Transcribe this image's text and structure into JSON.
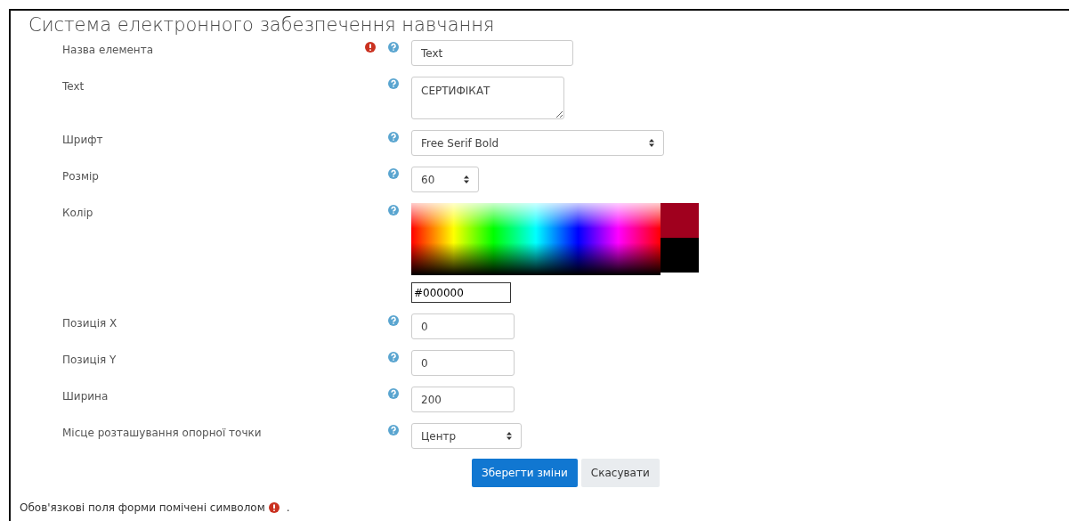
{
  "title": "Система електронного забезпечення навчання",
  "fields": [
    {
      "kind": "text",
      "label": "Назва елемента",
      "required": true,
      "value": "Text"
    },
    {
      "kind": "textarea",
      "label": "Text",
      "required": false,
      "value": "СЕРТИФІКАТ"
    },
    {
      "kind": "select",
      "label": "Шрифт",
      "required": false,
      "value": "Free Serif Bold"
    },
    {
      "kind": "select",
      "label": "Розмір",
      "required": false,
      "value": "60"
    },
    {
      "kind": "color",
      "label": "Колір",
      "required": false,
      "value": "#000000",
      "swatches": [
        {
          "color": "#a0001e"
        },
        {
          "color": "#000000"
        }
      ]
    },
    {
      "kind": "number",
      "label": "Позиція X",
      "required": false,
      "value": "0"
    },
    {
      "kind": "number",
      "label": "Позиція Y",
      "required": false,
      "value": "0"
    },
    {
      "kind": "number",
      "label": "Ширина",
      "required": false,
      "value": "200"
    },
    {
      "kind": "select",
      "label": "Місце розташування опорної точки",
      "required": false,
      "value": "Центр"
    }
  ],
  "buttons": [
    {
      "label": "Зберегти зміни",
      "kind": "primary"
    },
    {
      "label": "Скасувати",
      "kind": "secondary"
    }
  ],
  "footer": "Обов'язкові поля форми помічені символом",
  "footer_end": "."
}
